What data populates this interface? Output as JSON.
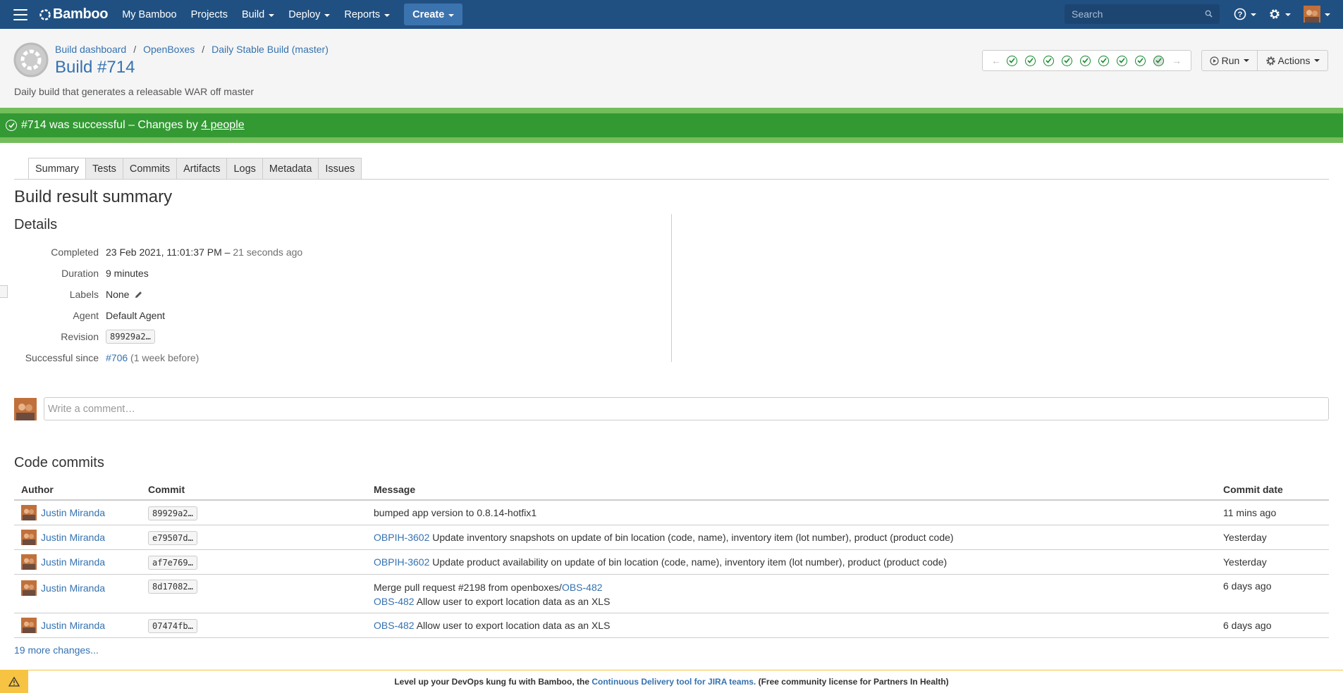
{
  "topnav": {
    "brand": "Bamboo",
    "items": [
      "My Bamboo",
      "Projects",
      "Build",
      "Deploy",
      "Reports"
    ],
    "create_label": "Create",
    "search_placeholder": "Search"
  },
  "header": {
    "breadcrumbs": [
      "Build dashboard",
      "OpenBoxes",
      "Daily Stable Build (master)"
    ],
    "title": "Build #714",
    "description": "Daily build that generates a releasable WAR off master",
    "run_label": "Run",
    "actions_label": "Actions"
  },
  "status": {
    "text": "#714 was successful – Changes by",
    "people_link": "4 people",
    "color": "#339933"
  },
  "tabs": [
    "Summary",
    "Tests",
    "Commits",
    "Artifacts",
    "Logs",
    "Metadata",
    "Issues"
  ],
  "summary": {
    "heading": "Build result summary",
    "details_heading": "Details",
    "completed_label": "Completed",
    "completed_value": "23 Feb 2021, 11:01:37 PM",
    "completed_sep": " – ",
    "completed_ago": "21 seconds ago",
    "duration_label": "Duration",
    "duration_value": "9 minutes",
    "labels_label": "Labels",
    "labels_value": "None",
    "agent_label": "Agent",
    "agent_value": "Default Agent",
    "revision_label": "Revision",
    "revision_value": "89929a2…",
    "since_label": "Successful since",
    "since_value": "#706",
    "since_note": "(1 week before)"
  },
  "comment": {
    "placeholder": "Write a comment…"
  },
  "commits": {
    "heading": "Code commits",
    "columns": [
      "Author",
      "Commit",
      "Message",
      "Commit date"
    ],
    "rows": [
      {
        "author": "Justin Miranda",
        "commit": "89929a2…",
        "issue": "",
        "message": "bumped app version to 0.8.14-hotfix1",
        "date": "11 mins ago"
      },
      {
        "author": "Justin Miranda",
        "commit": "e79507d…",
        "issue": "OBPIH-3602",
        "message": " Update inventory snapshots on update of bin location (code, name), inventory item (lot number), product (product code)",
        "date": "Yesterday"
      },
      {
        "author": "Justin Miranda",
        "commit": "af7e769…",
        "issue": "OBPIH-3602",
        "message": " Update product availability on update of bin location (code, name), inventory item (lot number), product (product code)",
        "date": "Yesterday"
      },
      {
        "author": "Justin Miranda",
        "commit": "8d17082…",
        "line1_prefix": "Merge pull request #2198 from openboxes/",
        "line1_issue": "OBS-482",
        "issue": "OBS-482",
        "message": " Allow user to export location data as an XLS",
        "date": "6 days ago"
      },
      {
        "author": "Justin Miranda",
        "commit": "07474fb…",
        "issue": "OBS-482",
        "message": " Allow user to export location data as an XLS",
        "date": "6 days ago"
      }
    ],
    "more_link": "19 more changes..."
  },
  "footer": {
    "prefix": "Level up your DevOps kung fu with Bamboo, the ",
    "link": "Continuous Delivery tool for JIRA teams.",
    "suffix": " (Free community license for Partners In Health)"
  },
  "colors": {
    "nav": "#205081",
    "link": "#3572b0",
    "success": "#339933",
    "warning": "#f6c342"
  }
}
